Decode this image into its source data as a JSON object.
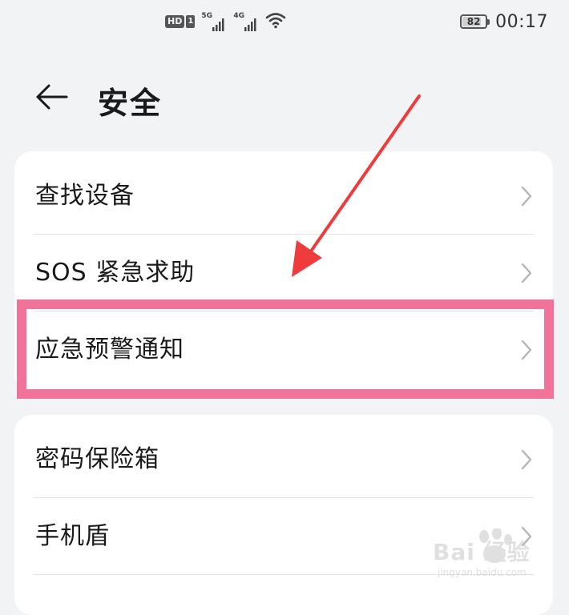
{
  "status_bar": {
    "hd_label": "HD",
    "sim_label": "1",
    "signal1_gen": "5G",
    "signal2_gen": "4G",
    "battery_level": "82",
    "time": "00:17"
  },
  "header": {
    "title": "安全"
  },
  "group1": [
    {
      "label": "查找设备"
    },
    {
      "label": "SOS 紧急求助"
    },
    {
      "label": "应急预警通知"
    }
  ],
  "group2": [
    {
      "label": "密码保险箱"
    },
    {
      "label": "手机盾"
    }
  ],
  "colors": {
    "highlight_border": "#f2739a",
    "arrow": "#ee3b3b",
    "background": "#f1f3f5",
    "card": "#ffffff"
  },
  "watermark": {
    "brand": "Bai 经验",
    "url": "jingyan.baidu.com"
  }
}
